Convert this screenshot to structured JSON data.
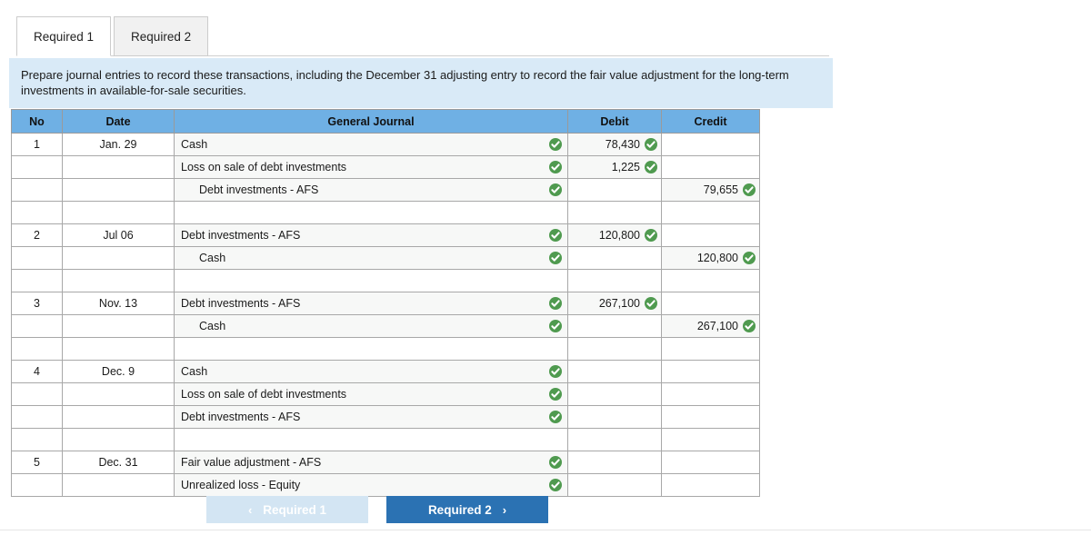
{
  "tabs": [
    {
      "label": "Required 1",
      "active": true
    },
    {
      "label": "Required 2",
      "active": false
    }
  ],
  "instruction": "Prepare journal entries to record these transactions, including the December 31 adjusting entry to record the fair value adjustment for the long-term investments in available-for-sale securities.",
  "table": {
    "headers": {
      "no": "No",
      "date": "Date",
      "journal": "General Journal",
      "debit": "Debit",
      "credit": "Credit"
    },
    "rows": [
      {
        "no": "1",
        "date": "Jan. 29",
        "account": "Cash",
        "indent": false,
        "account_check": true,
        "debit": "78,430",
        "debit_check": true,
        "credit": "",
        "credit_check": false
      },
      {
        "no": "",
        "date": "",
        "account": "Loss on sale of debt investments",
        "indent": false,
        "account_check": true,
        "debit": "1,225",
        "debit_check": true,
        "credit": "",
        "credit_check": false
      },
      {
        "no": "",
        "date": "",
        "account": "Debt investments - AFS",
        "indent": true,
        "account_check": true,
        "debit": "",
        "debit_check": false,
        "credit": "79,655",
        "credit_check": true
      },
      {
        "no": "",
        "date": "",
        "account": "",
        "indent": false,
        "account_check": false,
        "debit": "",
        "debit_check": false,
        "credit": "",
        "credit_check": false,
        "spacer": true
      },
      {
        "no": "2",
        "date": "Jul 06",
        "account": "Debt investments - AFS",
        "indent": false,
        "account_check": true,
        "debit": "120,800",
        "debit_check": true,
        "credit": "",
        "credit_check": false
      },
      {
        "no": "",
        "date": "",
        "account": "Cash",
        "indent": true,
        "account_check": true,
        "debit": "",
        "debit_check": false,
        "credit": "120,800",
        "credit_check": true
      },
      {
        "no": "",
        "date": "",
        "account": "",
        "indent": false,
        "account_check": false,
        "debit": "",
        "debit_check": false,
        "credit": "",
        "credit_check": false,
        "spacer": true
      },
      {
        "no": "3",
        "date": "Nov. 13",
        "account": "Debt investments - AFS",
        "indent": false,
        "account_check": true,
        "debit": "267,100",
        "debit_check": true,
        "credit": "",
        "credit_check": false
      },
      {
        "no": "",
        "date": "",
        "account": "Cash",
        "indent": true,
        "account_check": true,
        "debit": "",
        "debit_check": false,
        "credit": "267,100",
        "credit_check": true
      },
      {
        "no": "",
        "date": "",
        "account": "",
        "indent": false,
        "account_check": false,
        "debit": "",
        "debit_check": false,
        "credit": "",
        "credit_check": false,
        "spacer": true
      },
      {
        "no": "4",
        "date": "Dec. 9",
        "account": "Cash",
        "indent": false,
        "account_check": true,
        "debit": "",
        "debit_check": false,
        "credit": "",
        "credit_check": false
      },
      {
        "no": "",
        "date": "",
        "account": "Loss on sale of debt investments",
        "indent": false,
        "account_check": true,
        "debit": "",
        "debit_check": false,
        "credit": "",
        "credit_check": false
      },
      {
        "no": "",
        "date": "",
        "account": "Debt investments - AFS",
        "indent": false,
        "account_check": true,
        "debit": "",
        "debit_check": false,
        "credit": "",
        "credit_check": false
      },
      {
        "no": "",
        "date": "",
        "account": "",
        "indent": false,
        "account_check": false,
        "debit": "",
        "debit_check": false,
        "credit": "",
        "credit_check": false,
        "spacer": true
      },
      {
        "no": "5",
        "date": "Dec. 31",
        "account": "Fair value adjustment - AFS",
        "indent": false,
        "account_check": true,
        "debit": "",
        "debit_check": false,
        "credit": "",
        "credit_check": false
      },
      {
        "no": "",
        "date": "",
        "account": "Unrealized loss - Equity",
        "indent": false,
        "account_check": true,
        "debit": "",
        "debit_check": false,
        "credit": "",
        "credit_check": false
      }
    ]
  },
  "footer": {
    "prev_label": "Required 1",
    "prev_chevron": "‹",
    "next_label": "Required 2",
    "next_chevron": "›"
  },
  "colors": {
    "header_blue": "#6fb0e4",
    "banner_blue": "#d9eaf7",
    "button_blue": "#2b72b3",
    "button_disabled": "#d3e5f3",
    "check_green": "#4f9a4f"
  }
}
